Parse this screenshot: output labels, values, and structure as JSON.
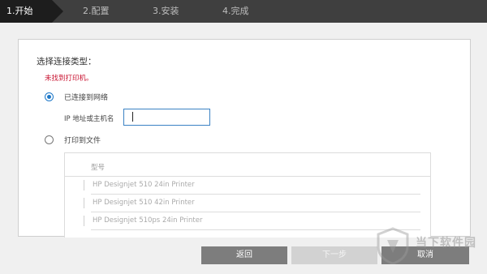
{
  "steps": [
    {
      "label": "1.开始",
      "active": true
    },
    {
      "label": "2.配置",
      "active": false
    },
    {
      "label": "3.安装",
      "active": false
    },
    {
      "label": "4.完成",
      "active": false
    }
  ],
  "main": {
    "title": "选择连接类型：",
    "error": "未找到打印机。",
    "options": {
      "network": {
        "label": "已连接到网络",
        "checked": true
      },
      "file": {
        "label": "打印到文件",
        "checked": false
      }
    },
    "ip_field": {
      "label": "IP 地址或主机名",
      "value": ""
    },
    "printer_list": {
      "header": "型号",
      "items": [
        "HP Designjet 510 24in Printer",
        "HP Designjet 510 42in Printer",
        "HP Designjet 510ps 24in Printer"
      ]
    }
  },
  "buttons": {
    "back": "返回",
    "next": "下一步",
    "cancel": "取消"
  },
  "watermark": {
    "text": "当下软件园",
    "icon": "shield-logo-icon"
  },
  "colors": {
    "accent": "#1e78c8",
    "error": "#c8102e",
    "step_bar": "#3f3f3f",
    "button": "#7d7d7d"
  }
}
